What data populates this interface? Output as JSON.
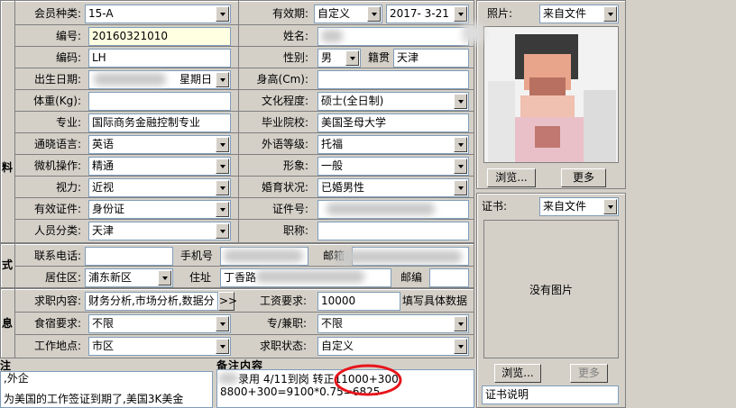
{
  "form": {
    "member_type_label": "会员种类:",
    "member_type_value": "15-A",
    "validity_label": "有效期:",
    "validity_type": "自定义",
    "validity_date": "2017- 3-21",
    "id_label": "编号:",
    "id_value": "20160321010",
    "name_label": "姓名:",
    "code_label": "编码:",
    "code_value": "LH",
    "gender_label": "性别:",
    "gender_value": "男",
    "native_label": "籍贯",
    "native_value": "天津",
    "birth_label": "出生日期:",
    "birth_weekday": "星期日",
    "height_label": "身高(Cm):",
    "weight_label": "体重(Kg):",
    "education_label": "文化程度:",
    "education_value": "硕士(全日制)",
    "major_label": "专业:",
    "major_value": "国际商务金融控制专业",
    "school_label": "毕业院校:",
    "school_value": "美国圣母大学",
    "language_label": "通晓语言:",
    "language_value": "英语",
    "foreign_level_label": "外语等级:",
    "foreign_level_value": "托福",
    "computer_label": "微机操作:",
    "computer_value": "精通",
    "appearance_label": "形象:",
    "appearance_value": "一般",
    "vision_label": "视力:",
    "vision_value": "近视",
    "marital_label": "婚育状况:",
    "marital_value": "已婚男性",
    "cert_label": "有效证件:",
    "cert_value": "身份证",
    "cert_no_label": "证件号:",
    "category_label": "人员分类:",
    "category_value": "天津",
    "title_label": "职称:"
  },
  "contact": {
    "phone_label": "联系电话:",
    "mobile_label": "手机号",
    "email_label": "邮箱",
    "area_label": "居住区:",
    "area_value": "浦东新区",
    "address_label": "住址",
    "address_value": "丁香路",
    "postcode_label": "邮编"
  },
  "job": {
    "content_label": "求职内容:",
    "content_value": "财务分析,市场分析,数据分",
    "more_btn": ">>",
    "salary_label": "工资要求:",
    "salary_value": "10000",
    "salary_hint": "填写具体数据",
    "board_label": "食宿要求:",
    "board_value": "不限",
    "fulltime_label": "专/兼职:",
    "fulltime_value": "不限",
    "location_label": "工作地点:",
    "location_value": "市区",
    "status_label": "求职状态:",
    "status_value": "自定义"
  },
  "side_chars": {
    "section1": "料",
    "section2": "式",
    "section3": "息"
  },
  "notes": {
    "left_title": "注",
    "left_line1": ",外企",
    "left_line2": "为美国的工作签证到期了,美国3K美金",
    "remark_title": "备注内容",
    "remark_line1": "录用 4/11到岗  转正11000+300",
    "remark_line2": "8800+300=9100*0.75=6825"
  },
  "photo": {
    "label": "照片:",
    "source": "来自文件",
    "browse": "浏览...",
    "more": "更多"
  },
  "certificate": {
    "label": "证书:",
    "source": "来自文件",
    "no_image": "没有图片",
    "browse": "浏览...",
    "more": "更多",
    "desc": "证书说明"
  }
}
